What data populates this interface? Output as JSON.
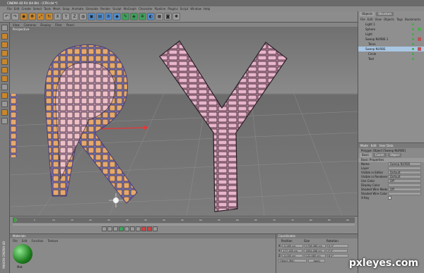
{
  "window": {
    "title": "CINEMA 4D R4 (64 Bit) - [CRY.c4d *]"
  },
  "menu": [
    "File",
    "Edit",
    "Create",
    "Select",
    "Tools",
    "Mesh",
    "Snap",
    "Animate",
    "Simulate",
    "Render",
    "Sculpt",
    "MoGraph",
    "Character",
    "Pipeline",
    "Plugins",
    "Script",
    "Window",
    "Help"
  ],
  "toolbar": {
    "icons": [
      "undo-icon",
      "redo-icon",
      "live-select-icon",
      "move-icon",
      "scale-icon",
      "rotate-icon",
      "x-axis-icon",
      "y-axis-icon",
      "z-axis-icon",
      "world-icon",
      "render-view-icon",
      "render-picture-icon",
      "render-settings-icon",
      "cube-icon",
      "pen-icon",
      "subdivision-icon",
      "array-icon",
      "deformer-icon",
      "scene-icon",
      "camera-icon",
      "light-icon"
    ],
    "axis_labels": [
      "X",
      "Y",
      "Z"
    ]
  },
  "viewport": {
    "menu": [
      "View",
      "Cameras",
      "Display",
      "Filter",
      "Panel"
    ],
    "label": "Perspective",
    "letters": [
      "R",
      "Y"
    ]
  },
  "object_manager": {
    "tabs": [
      "Objects",
      "Structure"
    ],
    "menu": [
      "File",
      "Edit",
      "View",
      "Objects",
      "Tags",
      "Bookmarks"
    ],
    "items": [
      {
        "label": "Light 1",
        "selected": false
      },
      {
        "label": "Sphere",
        "selected": false
      },
      {
        "label": "Light",
        "selected": false
      },
      {
        "label": "Sweep NURBS 1",
        "selected": false
      },
      {
        "label": "Torus",
        "selected": false
      },
      {
        "label": "Sweep NURBS",
        "selected": true
      },
      {
        "label": "Circle",
        "selected": false
      },
      {
        "label": "Text",
        "selected": false
      }
    ]
  },
  "attribute_manager": {
    "menu": [
      "Mode",
      "Edit",
      "User Data"
    ],
    "object_label": "Polygon Object [Sweep NURBS]",
    "tabs": [
      "Basic",
      "Coord.",
      "Object"
    ],
    "section": "Basic Properties",
    "rows": [
      {
        "key": "Name",
        "value": "Sweep NURBS"
      },
      {
        "key": "Layer",
        "value": ""
      },
      {
        "key": "Visible in Editor",
        "value": "Default"
      },
      {
        "key": "Visible in Renderer",
        "value": "Default"
      },
      {
        "key": "Use Color",
        "value": "Off"
      },
      {
        "key": "Display Color",
        "value": ""
      },
      {
        "key": "Shaded Wire Mode",
        "value": "Off"
      },
      {
        "key": "Shaded Wire Color",
        "value": ""
      },
      {
        "key": "X-Ray",
        "value": ""
      }
    ]
  },
  "timeline": {
    "ticks": [
      "0",
      "5",
      "10",
      "15",
      "20",
      "25",
      "30",
      "35",
      "40",
      "45",
      "50",
      "55",
      "60",
      "65",
      "70",
      "75",
      "80",
      "85",
      "90"
    ]
  },
  "material_manager": {
    "title": "Materials",
    "menu": [
      "File",
      "Edit",
      "Function",
      "Texture"
    ],
    "material_label": "Mat"
  },
  "coordinates": {
    "title": "Coordinates",
    "headers": [
      "Position",
      "Size",
      "Rotation"
    ],
    "rows": [
      {
        "axis": "X",
        "pos": "-5.289 cm",
        "size": "1758.386 cm",
        "rot": "H 0°"
      },
      {
        "axis": "Y",
        "pos": "177.185 cm",
        "size": "1694.468 cm",
        "rot": "P 0°"
      },
      {
        "axis": "Z",
        "pos": "-0.000 cm",
        "size": "122.085 cm",
        "rot": "B 0°"
      }
    ],
    "mode": "Object (Rel)",
    "apply_label": "Apply"
  },
  "left_side_label": "MAXON CINEMA 4D",
  "watermark": "pxleyes.com",
  "colors": {
    "accent_orange": "#c9872c",
    "selection_blue": "#a9c6e3",
    "pink_letters": "#e7a5c2"
  }
}
